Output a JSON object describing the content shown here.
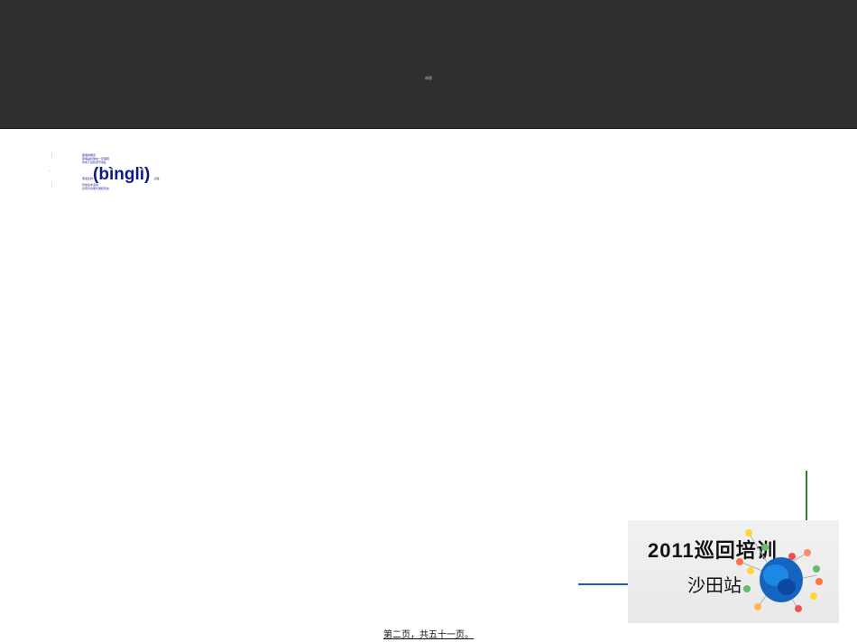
{
  "header": {
    "title": "病理"
  },
  "content": {
    "bullets": [
      "⋮",
      "·",
      "⋮"
    ],
    "line1": "疾病的概念",
    "line2": "疾病是机体在一定病因",
    "line3": "作用下自稳调节紊乱",
    "line4_prefix": "而发生的",
    "line4_term": "(bìnglì)",
    "line4_note": "过程",
    "line5": "异常生命活动",
    "line6": "表现为功能代谢和形态",
    "line4_suffix": "",
    "line_misc": ""
  },
  "logo": {
    "line1": "2011巡回培训",
    "line2": "沙田站"
  },
  "footer": {
    "text": "第二页，共五十一页。"
  },
  "colors": {
    "header_bg": "#2f2f2f",
    "text_blue": "#0d1a86",
    "accent_green": "#2e7d32",
    "accent_blue": "#1f5fc2"
  }
}
